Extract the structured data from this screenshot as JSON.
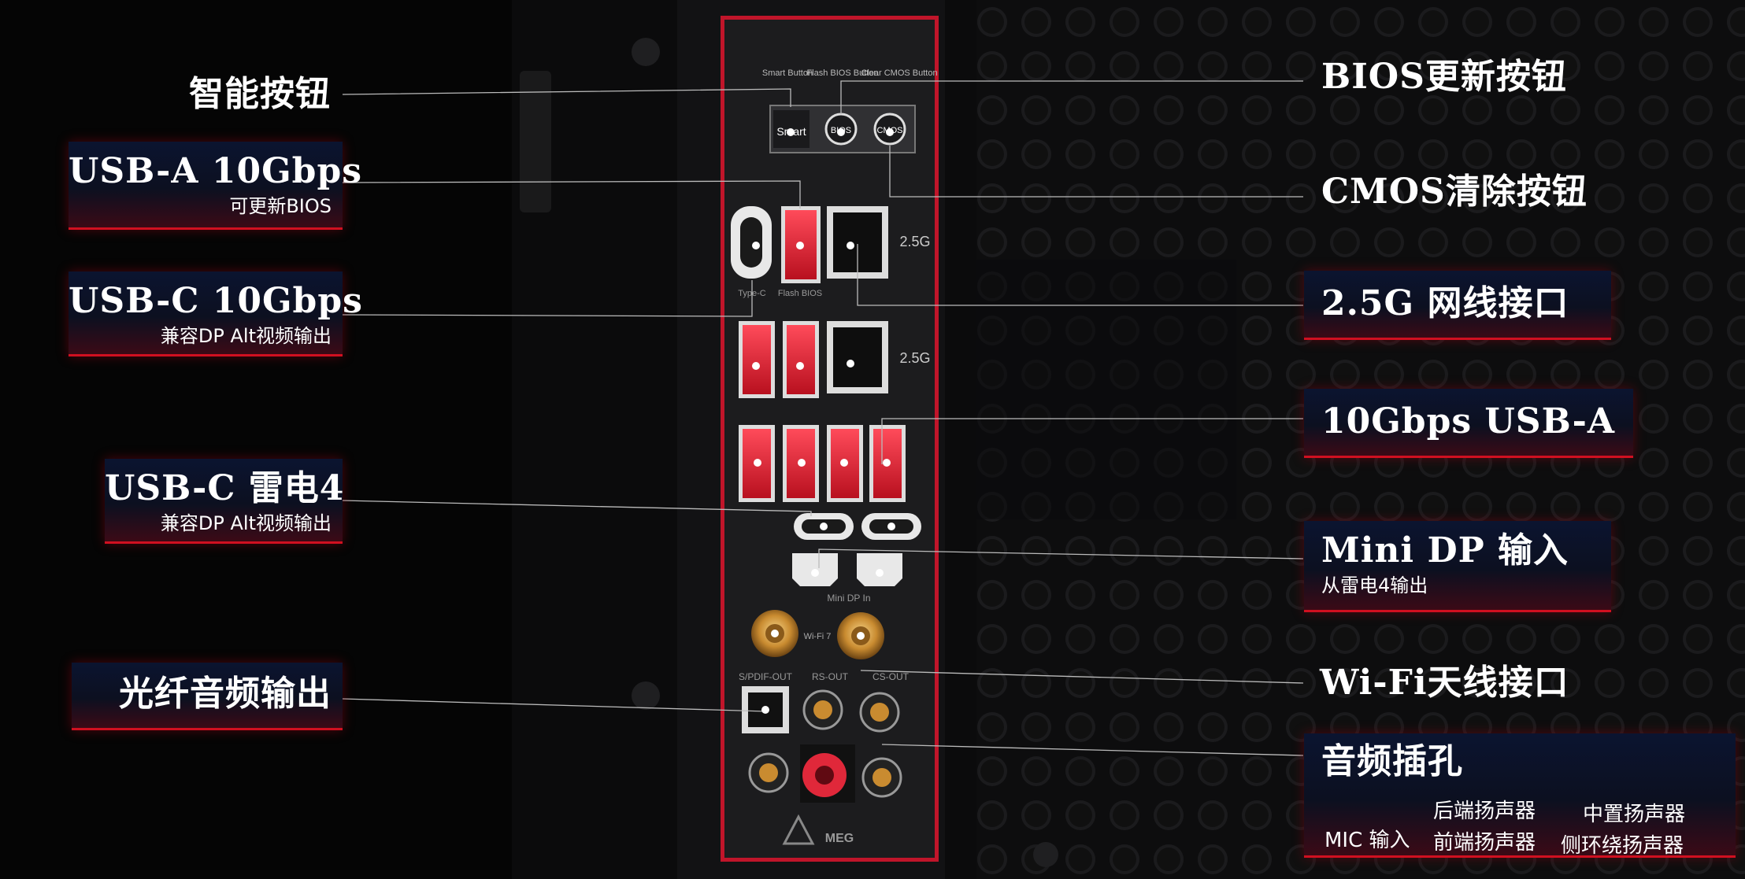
{
  "left_labels": {
    "smart_button": {
      "title": "智能按钮"
    },
    "usb_a_bios": {
      "title": "USB-A 10Gbps",
      "subtitle": "可更新BIOS"
    },
    "usb_c": {
      "title": "USB-C 10Gbps",
      "subtitle": "兼容DP Alt视频输出"
    },
    "usb_c_tb4": {
      "title": "USB-C  雷电4",
      "subtitle": "兼容DP Alt视频输出"
    },
    "optical": {
      "title": "光纤音频输出"
    }
  },
  "right_labels": {
    "bios_update": {
      "title": "BIOS更新按钮"
    },
    "cmos_clear": {
      "title": "CMOS清除按钮"
    },
    "lan": {
      "title": "2.5G 网线接口"
    },
    "usb_a": {
      "title": "10Gbps USB-A"
    },
    "mini_dp": {
      "title": "Mini DP 输入",
      "subtitle": "从雷电4输出"
    },
    "wifi": {
      "title": "Wi-Fi天线接口"
    },
    "audio": {
      "title": "音频插孔",
      "items": {
        "mic": "MIC 输入",
        "rear": "后端扬声器",
        "front": "前端扬声器",
        "center": "中置扬声器",
        "side": "侧环绕扬声器"
      }
    }
  },
  "io_panel": {
    "button_captions": [
      "Smart Button",
      "Flash BIOS Button",
      "Clear CMOS Button"
    ],
    "button_labels": [
      "Smart",
      "BIOS",
      "CMOS"
    ],
    "lan_speed": [
      "2.5G",
      "2.5G"
    ],
    "typec_caption": "Type-C",
    "flash_bios_caption": "Flash BIOS",
    "minidp_caption": "Mini DP In",
    "wifi_caption": "Wi-Fi 7",
    "audio_captions": [
      "S/PDIF-OUT",
      "RS-OUT",
      "CS-OUT"
    ],
    "logo": "MEG"
  },
  "colors": {
    "accent": "#d01020",
    "panel": "#1c1c1e",
    "port_red": "#e0283a",
    "gold": "#d4a24a"
  }
}
